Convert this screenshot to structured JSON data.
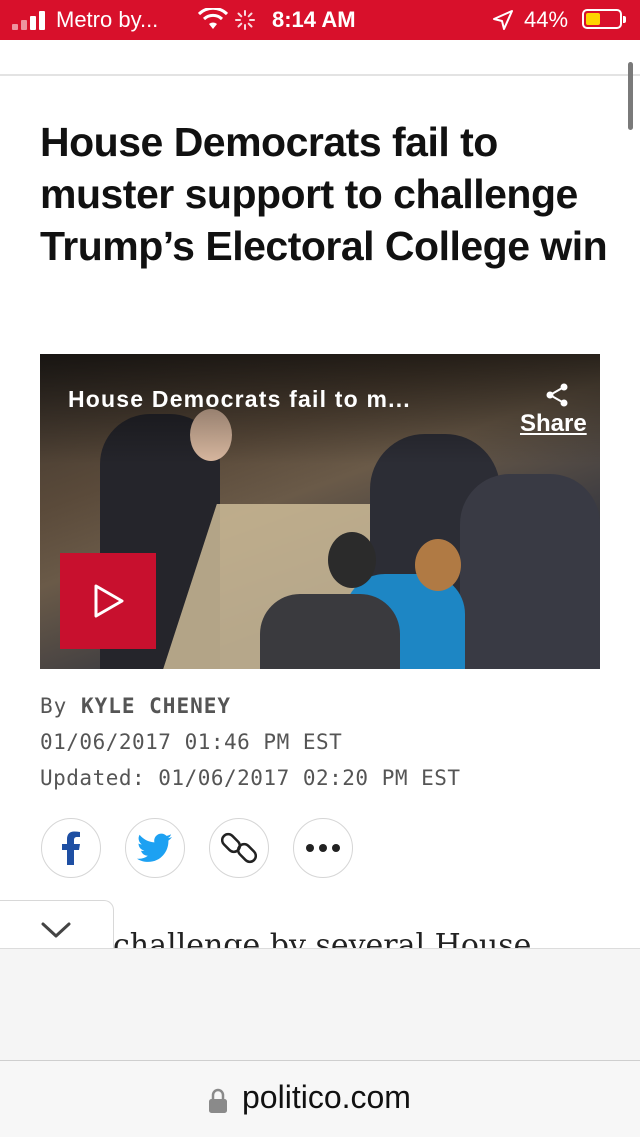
{
  "status_bar": {
    "carrier": "Metro by...",
    "time": "8:14 AM",
    "battery_percent": "44%",
    "colors": {
      "background": "#d8102b",
      "battery_fill": "#ffd400"
    }
  },
  "article": {
    "headline": "House Democrats fail to muster support to challenge Trump’s Electoral College win",
    "video": {
      "title": "House Democrats fail to m...",
      "share_label": "Share",
      "play_color": "#c8102e"
    },
    "byline_prefix": "By",
    "author": "KYLE CHENEY",
    "published": "01/06/2017 01:46 PM EST",
    "updated": "Updated: 01/06/2017 02:20 PM EST",
    "social": [
      "facebook-icon",
      "twitter-icon",
      "link-icon",
      "more-icon"
    ],
    "body_snippet": "challenge by several House"
  },
  "browser": {
    "url": "politico.com"
  }
}
